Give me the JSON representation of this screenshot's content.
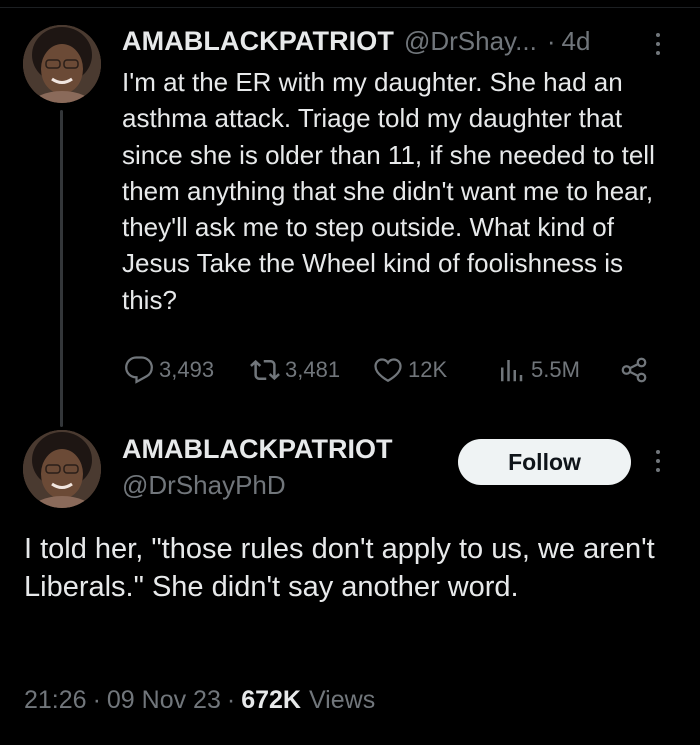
{
  "parent_tweet": {
    "author_name": "AMABLACKPATRIOT",
    "handle": "@DrShay...",
    "separator": "·",
    "age": "4d",
    "text": "I'm at the ER with my daughter. She had an asthma attack. Triage told my daughter that since she is older than 11, if she needed to tell them anything that she didn't want me to hear, they'll ask me to step outside. What kind of Jesus Take the Wheel kind of foolishness is this?",
    "stats": {
      "replies": "3,493",
      "reposts": "3,481",
      "likes": "12K",
      "views": "5.5M"
    }
  },
  "main_tweet": {
    "author_name": "AMABLACKPATRIOT",
    "handle": "@DrShayPhD",
    "follow_label": "Follow",
    "text": "I told her, \"those rules don't apply to us, we aren't Liberals.\" She didn't say another word.",
    "time": "21:26",
    "date": "09 Nov 23",
    "separator": "·",
    "views_count": "672K",
    "views_label": "Views"
  },
  "colors": {
    "background": "#000000",
    "text_primary": "#e7e9ea",
    "text_secondary": "#71767b",
    "button_bg": "#eff3f4",
    "button_text": "#0f1419",
    "thread_line": "#333639"
  },
  "icons": [
    "reply-icon",
    "repost-icon",
    "like-icon",
    "views-icon",
    "share-icon",
    "more-icon"
  ]
}
